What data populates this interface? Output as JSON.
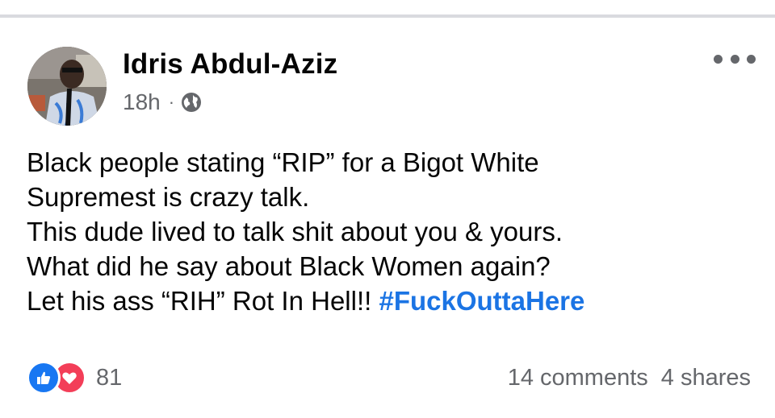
{
  "post": {
    "author": "Idris Abdul-Aziz",
    "time": "18h",
    "separator": "·",
    "audience_icon": "globe-icon",
    "menu_icon": "more-options-icon",
    "lines": [
      "Black people stating “RIP” for a Bigot White",
      "Supremest is crazy talk.",
      "This dude lived to talk shit about you & yours.",
      "What did he say about Black Women again?",
      "Let his ass “RIH” Rot In Hell!! "
    ],
    "hashtag": "#FuckOuttaHere"
  },
  "footer": {
    "reaction_icons": [
      "like-icon",
      "love-icon"
    ],
    "reaction_count": "81",
    "comments": "14 comments",
    "shares": "4 shares"
  },
  "colors": {
    "hashtag": "#1b74e4",
    "secondary_text": "#65676b",
    "like": "#1877f2",
    "love": "#f33e58",
    "divider": "#d9dadf"
  }
}
